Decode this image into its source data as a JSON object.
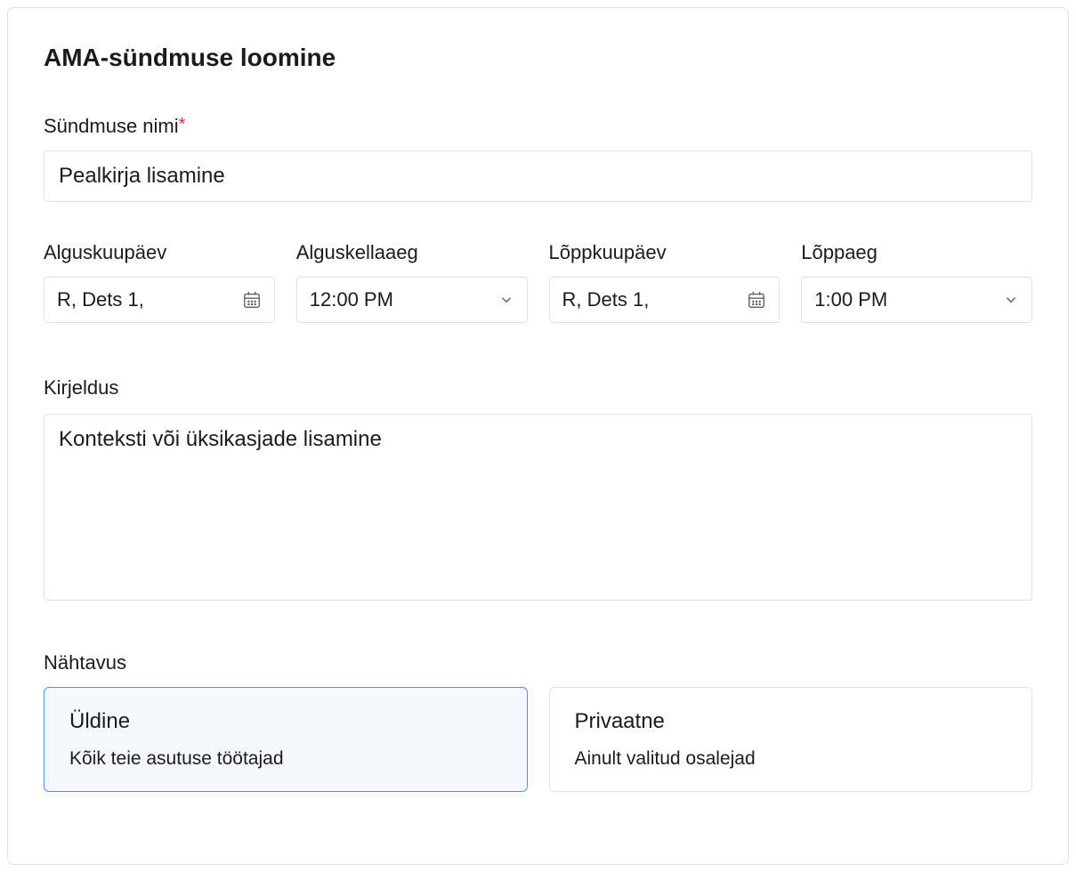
{
  "dialog": {
    "title": "AMA-sündmuse loomine"
  },
  "eventName": {
    "label": "Sündmuse nimi",
    "placeholder": "Pealkirja lisamine"
  },
  "dateTime": {
    "startDateLabel": "Alguskuupäev",
    "startDateValue": "R, Dets 1,",
    "startTimeLabel": "Alguskellaaeg",
    "startTimeValue": "12:00 PM",
    "endDateLabel": "Lõppkuupäev",
    "endDateValue": "R, Dets 1,",
    "endTimeLabel": "Lõppaeg",
    "endTimeValue": "1:00 PM"
  },
  "description": {
    "label": "Kirjeldus",
    "placeholder": "Konteksti või üksikasjade lisamine"
  },
  "visibility": {
    "label": "Nähtavus",
    "public": {
      "title": "Üldine",
      "subtitle": "Kõik teie asutuse töötajad"
    },
    "private": {
      "title": "Privaatne",
      "subtitle": "Ainult valitud osalejad"
    }
  }
}
